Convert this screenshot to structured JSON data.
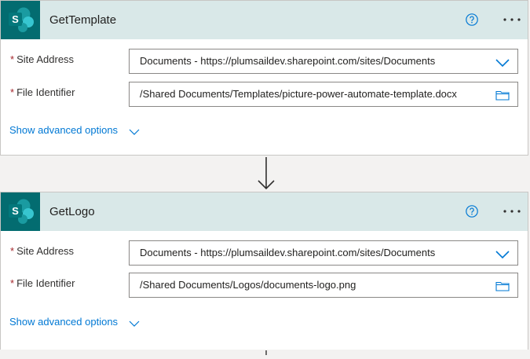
{
  "actions": [
    {
      "title": "GetTemplate",
      "fields": [
        {
          "label": "Site Address",
          "value": "Documents - https://plumsaildev.sharepoint.com/sites/Documents",
          "icon": "chevron-down-icon"
        },
        {
          "label": "File Identifier",
          "value": "/Shared Documents/Templates/picture-power-automate-template.docx",
          "icon": "folder-icon"
        }
      ],
      "advanced_label": "Show advanced options"
    },
    {
      "title": "GetLogo",
      "fields": [
        {
          "label": "Site Address",
          "value": "Documents - https://plumsaildev.sharepoint.com/sites/Documents",
          "icon": "chevron-down-icon"
        },
        {
          "label": "File Identifier",
          "value": "/Shared Documents/Logos/documents-logo.png",
          "icon": "folder-icon"
        }
      ],
      "advanced_label": "Show advanced options"
    }
  ],
  "required_marker": "*",
  "colors": {
    "header_bg": "#d9e8e8",
    "logo_bg": "#036c70",
    "link": "#0078d4",
    "required": "#a4262c",
    "canvas": "#f3f2f1"
  }
}
